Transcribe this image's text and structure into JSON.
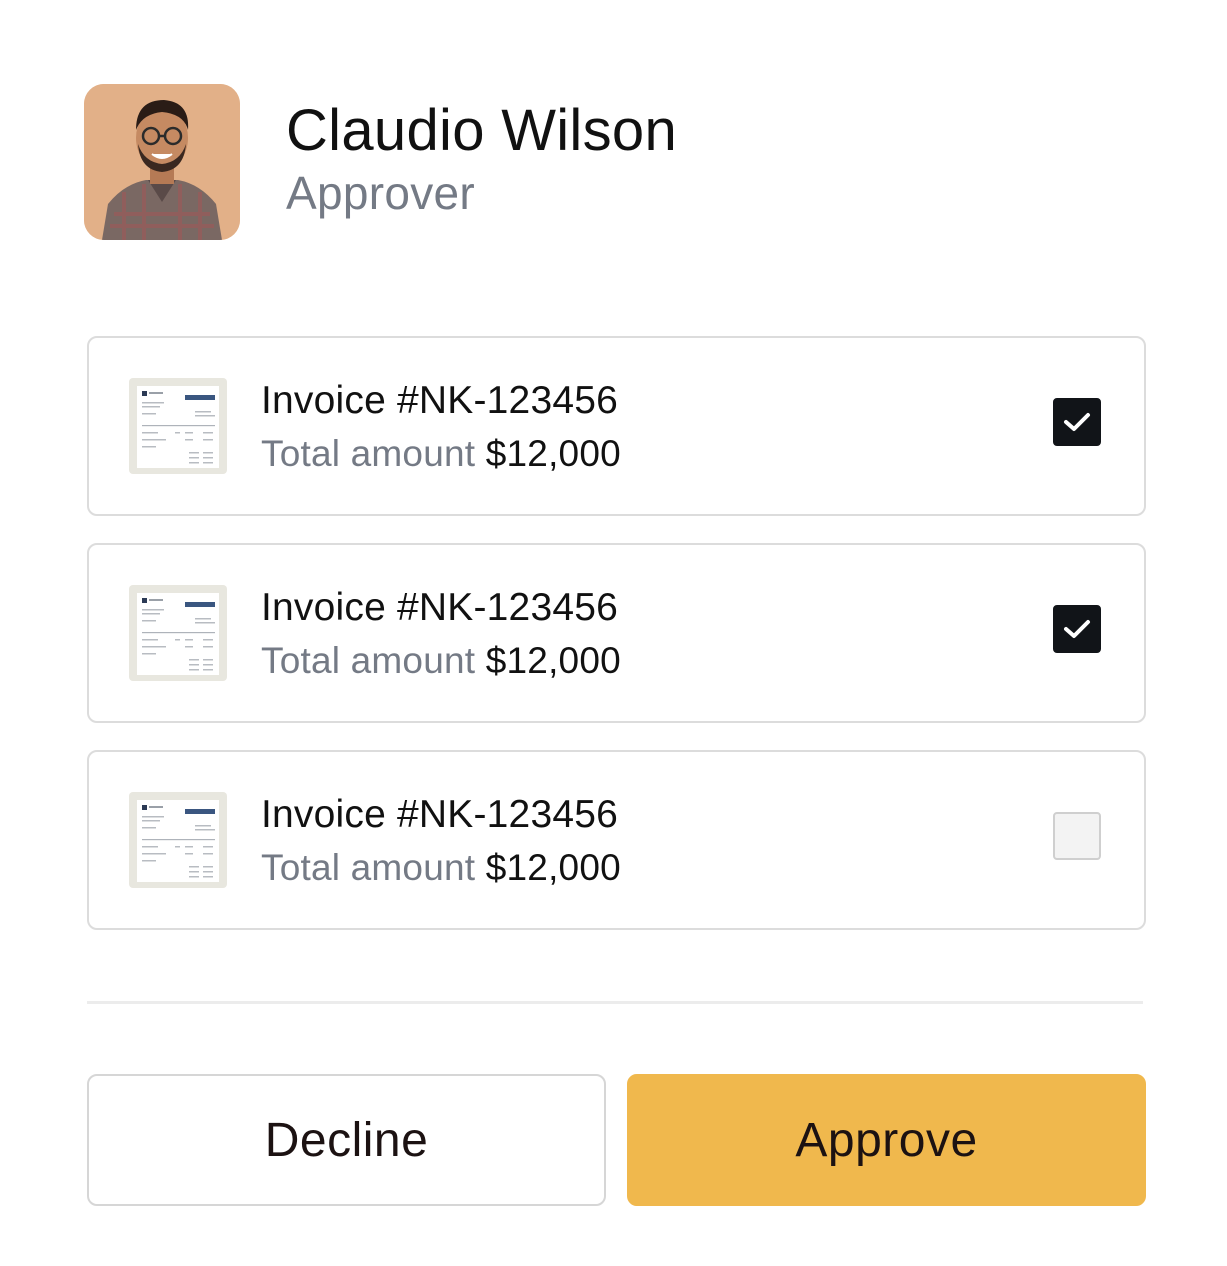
{
  "user": {
    "name": "Claudio Wilson",
    "role": "Approver"
  },
  "invoices": [
    {
      "title": "Invoice #NK-123456",
      "amount_label": "Total amount",
      "amount_value": "$12,000",
      "selected": true
    },
    {
      "title": "Invoice #NK-123456",
      "amount_label": "Total amount",
      "amount_value": "$12,000",
      "selected": true
    },
    {
      "title": "Invoice #NK-123456",
      "amount_label": "Total amount",
      "amount_value": "$12,000",
      "selected": false
    }
  ],
  "actions": {
    "decline_label": "Decline",
    "approve_label": "Approve"
  },
  "colors": {
    "accent": "#f0b84d",
    "checkbox_checked": "#111418",
    "muted_text": "#747a85"
  },
  "icons": {
    "checkbox_checked": "checkmark-icon",
    "invoice_thumbnail": "invoice-document-icon"
  }
}
